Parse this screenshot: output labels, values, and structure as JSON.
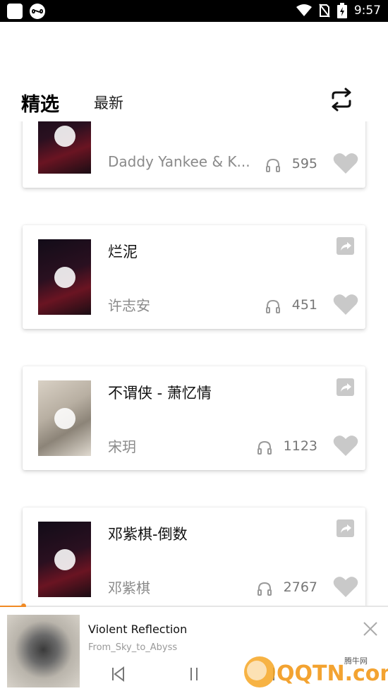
{
  "status_bar": {
    "time": "9:57",
    "icons": [
      "app-square-icon",
      "infinity-icon",
      "wifi-icon",
      "no-sim-icon",
      "battery-charging-icon"
    ]
  },
  "tabs": [
    {
      "label": "精选",
      "active": true
    },
    {
      "label": "最新",
      "active": false
    }
  ],
  "header": {
    "repeat_icon": "repeat-icon"
  },
  "songs": [
    {
      "title": "",
      "artist": "Daddy Yankee & K...",
      "listens": "595",
      "cover": "dark-red"
    },
    {
      "title": "烂泥",
      "artist": "许志安",
      "listens": "451",
      "cover": "dark-red"
    },
    {
      "title": "不谓侠 - 萧忆情",
      "artist": "宋玥",
      "listens": "1123",
      "cover": "beige-fan"
    },
    {
      "title": "邓紫棋-倒数",
      "artist": "邓紫棋",
      "listens": "2767",
      "cover": "dark-red"
    }
  ],
  "now_playing": {
    "title": "Violent Reflection",
    "artist": "From_Sky_to_Abyss",
    "progress_percent": 6
  },
  "watermark": {
    "main": "QQTN.com",
    "small": "腾牛网"
  },
  "colors": {
    "accent": "#f08a24",
    "icon_gray": "#c9c9c9",
    "artist_gray": "#8a8a8a"
  }
}
